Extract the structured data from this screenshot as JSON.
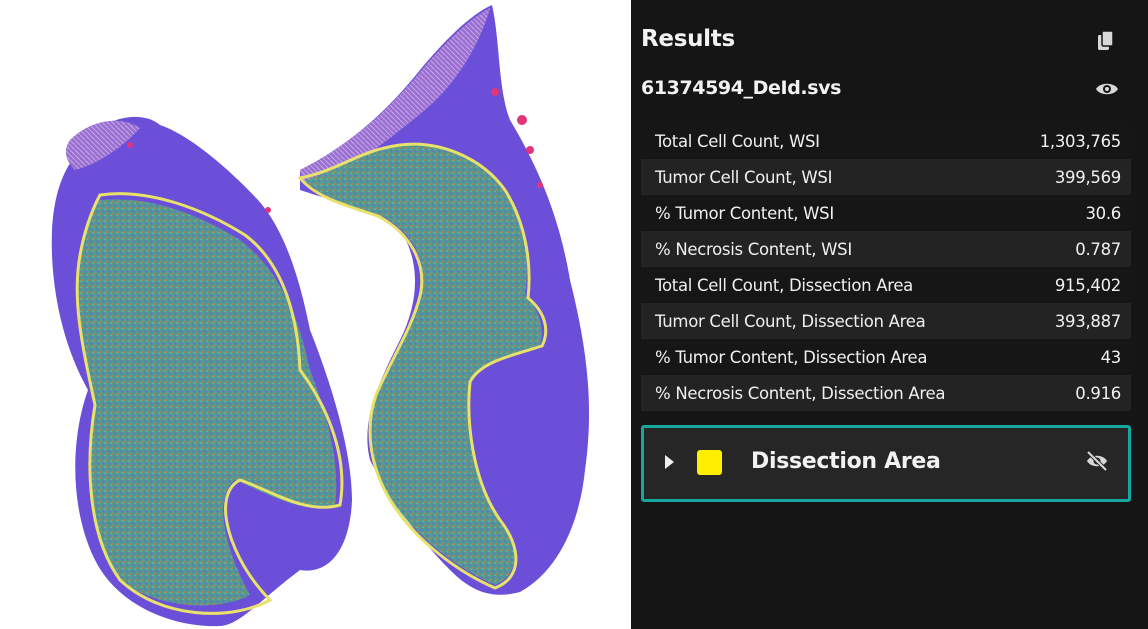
{
  "panel": {
    "title": "Results",
    "file_name": "61374594_DeId.svs",
    "icons": {
      "copy": "copy-icon",
      "view": "eye-icon"
    }
  },
  "metrics": [
    {
      "label": "Total Cell Count, WSI",
      "value": "1,303,765"
    },
    {
      "label": "Tumor Cell Count, WSI",
      "value": "399,569"
    },
    {
      "label": "% Tumor Content, WSI",
      "value": "30.6"
    },
    {
      "label": "% Necrosis Content, WSI",
      "value": "0.787"
    },
    {
      "label": "Total Cell Count, Dissection Area",
      "value": "915,402"
    },
    {
      "label": "Tumor Cell Count, Dissection Area",
      "value": "393,887"
    },
    {
      "label": "% Tumor Content, Dissection Area",
      "value": "43"
    },
    {
      "label": "% Necrosis Content, Dissection Area",
      "value": "0.916"
    }
  ],
  "layer": {
    "name": "Dissection Area",
    "color": "#ffee00",
    "icons": {
      "expand": "caret-right-icon",
      "visibility": "eye-slash-icon"
    }
  },
  "colors": {
    "panel_bg": "#151515",
    "accent_border": "#15a6a0",
    "tissue": "#6b4fd9",
    "annotation_outline": "#e8e26a",
    "tumor_overlay": "#4f9e8e"
  }
}
